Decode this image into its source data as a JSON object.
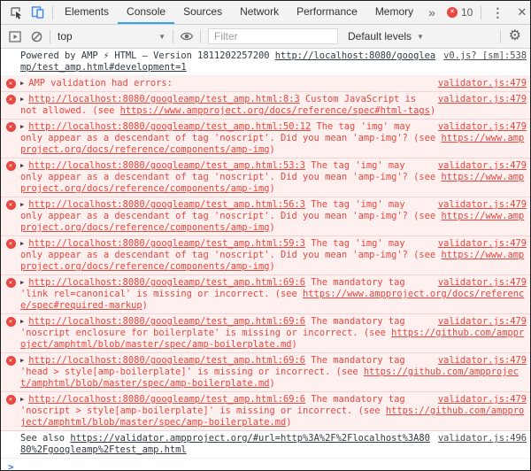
{
  "header": {
    "tabs": [
      "Elements",
      "Console",
      "Sources",
      "Network",
      "Performance",
      "Memory"
    ],
    "active_tab": "Console",
    "error_count": "10"
  },
  "toolbar": {
    "context": "top",
    "filter_placeholder": "Filter",
    "levels": "Default levels"
  },
  "icons": {
    "more_tabs": "»",
    "menu": "⋮",
    "close": "✕",
    "dropdown_arrow": "▼",
    "expand_triangle": "▶",
    "gear": "⚙",
    "error_badge": "✕",
    "prompt": ">"
  },
  "colors": {
    "accent_blue": "#38a1ea",
    "error_red": "#e8473f",
    "error_bg": "#fdf0ef",
    "error_border": "#f2d4d2",
    "link_gray": "#4d4d4d",
    "prompt_blue": "#367cf3",
    "device_icon_blue": "#4285f4"
  },
  "console": {
    "messages": [
      {
        "level": "log",
        "expandable": false,
        "source": "v0.js? [sm]:538",
        "parts": [
          {
            "text": "Powered by AMP ⚡ HTML – Version 1811202257200 "
          },
          {
            "text": "http://localhost:8080/googleamp/test_amp.html#development=1",
            "link": true
          }
        ]
      },
      {
        "level": "error",
        "expandable": true,
        "source": "validator.js:479",
        "parts": [
          {
            "text": "AMP validation had errors:"
          }
        ]
      },
      {
        "level": "error",
        "expandable": true,
        "source": "validator.js:479",
        "parts": [
          {
            "text": "http://localhost:8080/googleamp/test_amp.html:8:3",
            "link": true
          },
          {
            "text": " Custom JavaScript is not allowed. (see "
          },
          {
            "text": "https://www.ampproject.org/docs/reference/spec#html-tags",
            "link": true
          },
          {
            "text": ")"
          }
        ]
      },
      {
        "level": "error",
        "expandable": true,
        "source": "validator.js:479",
        "parts": [
          {
            "text": "http://localhost:8080/googleamp/test_amp.html:50:12",
            "link": true
          },
          {
            "text": " The tag 'img' may only appear as a descendant of tag 'noscript'. Did you mean 'amp-img'? (see "
          },
          {
            "text": "https://www.ampproject.org/docs/reference/components/amp-img",
            "link": true
          },
          {
            "text": ")"
          }
        ]
      },
      {
        "level": "error",
        "expandable": true,
        "source": "validator.js:479",
        "parts": [
          {
            "text": "http://localhost:8080/googleamp/test_amp.html:53:3",
            "link": true
          },
          {
            "text": " The tag 'img' may only appear as a descendant of tag 'noscript'. Did you mean 'amp-img'? (see "
          },
          {
            "text": "https://www.ampproject.org/docs/reference/components/amp-img",
            "link": true
          },
          {
            "text": ")"
          }
        ]
      },
      {
        "level": "error",
        "expandable": true,
        "source": "validator.js:479",
        "parts": [
          {
            "text": "http://localhost:8080/googleamp/test_amp.html:56:3",
            "link": true
          },
          {
            "text": " The tag 'img' may only appear as a descendant of tag 'noscript'. Did you mean 'amp-img'? (see "
          },
          {
            "text": "https://www.ampproject.org/docs/reference/components/amp-img",
            "link": true
          },
          {
            "text": ")"
          }
        ]
      },
      {
        "level": "error",
        "expandable": true,
        "source": "validator.js:479",
        "parts": [
          {
            "text": "http://localhost:8080/googleamp/test_amp.html:59:3",
            "link": true
          },
          {
            "text": " The tag 'img' may only appear as a descendant of tag 'noscript'. Did you mean 'amp-img'? (see "
          },
          {
            "text": "https://www.ampproject.org/docs/reference/components/amp-img",
            "link": true
          },
          {
            "text": ")"
          }
        ]
      },
      {
        "level": "error",
        "expandable": true,
        "source": "validator.js:479",
        "parts": [
          {
            "text": "http://localhost:8080/googleamp/test_amp.html:69:6",
            "link": true
          },
          {
            "text": " The mandatory tag 'link rel=canonical' is missing or incorrect. (see "
          },
          {
            "text": "https://www.ampproject.org/docs/reference/spec#required-markup",
            "link": true
          },
          {
            "text": ")"
          }
        ]
      },
      {
        "level": "error",
        "expandable": true,
        "source": "validator.js:479",
        "parts": [
          {
            "text": "http://localhost:8080/googleamp/test_amp.html:69:6",
            "link": true
          },
          {
            "text": " The mandatory tag 'noscript enclosure for boilerplate' is missing or incorrect. (see "
          },
          {
            "text": "https://github.com/ampproject/amphtml/blob/master/spec/amp-boilerplate.md",
            "link": true
          },
          {
            "text": ")"
          }
        ]
      },
      {
        "level": "error",
        "expandable": true,
        "source": "validator.js:479",
        "parts": [
          {
            "text": "http://localhost:8080/googleamp/test_amp.html:69:6",
            "link": true
          },
          {
            "text": " The mandatory tag 'head > style[amp-boilerplate]' is missing or incorrect. (see "
          },
          {
            "text": "https://github.com/ampproject/amphtml/blob/master/spec/amp-boilerplate.md",
            "link": true
          },
          {
            "text": ")"
          }
        ]
      },
      {
        "level": "error",
        "expandable": true,
        "source": "validator.js:479",
        "parts": [
          {
            "text": "http://localhost:8080/googleamp/test_amp.html:69:6",
            "link": true
          },
          {
            "text": " The mandatory tag 'noscript > style[amp-boilerplate]' is missing or incorrect. (see "
          },
          {
            "text": "https://github.com/ampproject/amphtml/blob/master/spec/amp-boilerplate.md",
            "link": true
          },
          {
            "text": ")"
          }
        ]
      },
      {
        "level": "log",
        "expandable": false,
        "source": "validator.js:496",
        "parts": [
          {
            "text": "See also "
          },
          {
            "text": "https://validator.ampproject.org/#url=http%3A%2F%2Flocalhost%3A8080%2Fgoogleamp%2Ftest_amp.html",
            "link": true
          }
        ]
      }
    ]
  }
}
